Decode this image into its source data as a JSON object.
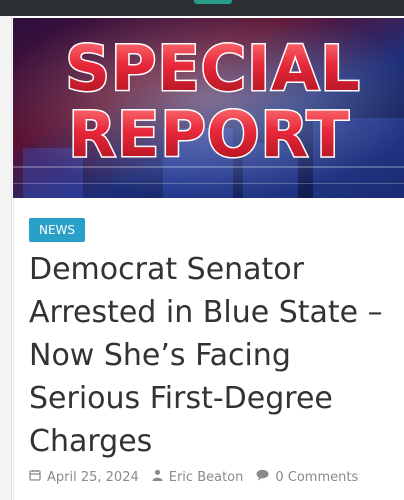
{
  "hero": {
    "line1": "SPECIAL",
    "line2": "REPORT",
    "icon": "special-report-banner"
  },
  "article": {
    "category": "NEWS",
    "title": "Democrat Senator Arrested in Blue State – Now She’s Facing Serious First-Degree Charges",
    "date": "April 25, 2024",
    "author": "Eric Beaton",
    "comments": "0 Comments"
  },
  "colors": {
    "badge": "#29a0c8",
    "title_text": "#333333",
    "meta_text": "#8a8a8a",
    "topbar": "#2c3034",
    "topbar_accent": "#2a9d8a"
  },
  "icons": {
    "date": "calendar-icon",
    "author": "user-icon",
    "comments": "comment-icon"
  }
}
